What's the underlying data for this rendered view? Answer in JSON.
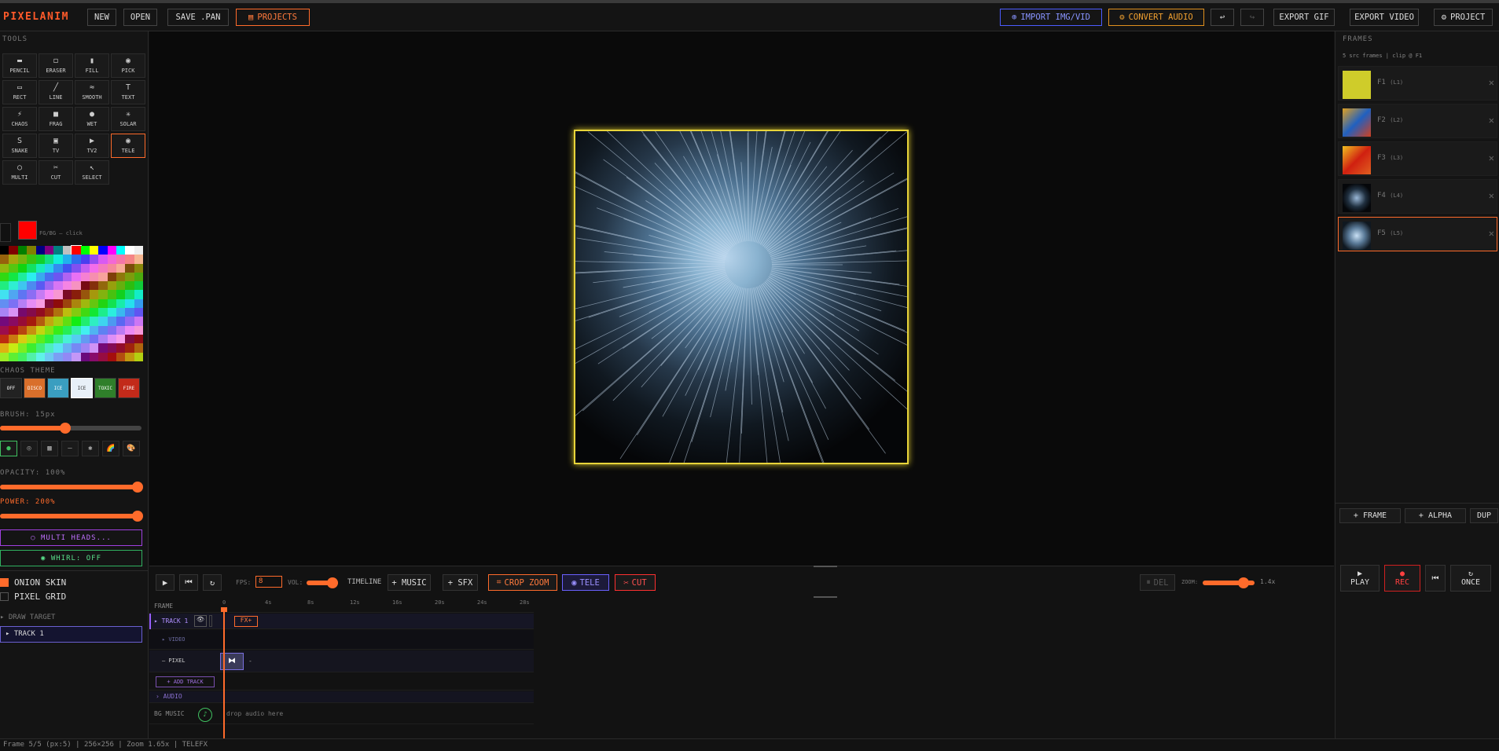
{
  "app": {
    "logo": "PIXELANIM"
  },
  "topbar": {
    "new": "NEW",
    "open": "OPEN",
    "save": "SAVE .PAN",
    "projects": "PROJECTS",
    "import": "IMPORT IMG/VID",
    "convert_audio": "CONVERT AUDIO",
    "undo": "↩",
    "redo": "↪",
    "export_gif": "EXPORT GIF",
    "export_video": "EXPORT VIDEO",
    "project": "PROJECT"
  },
  "tools": {
    "title": "TOOLS",
    "items": [
      {
        "label": "PENCIL",
        "icon": "▬"
      },
      {
        "label": "ERASER",
        "icon": "◻"
      },
      {
        "label": "FILL",
        "icon": "▮"
      },
      {
        "label": "PICK",
        "icon": "◉"
      },
      {
        "label": "RECT",
        "icon": "▭"
      },
      {
        "label": "LINE",
        "icon": "╱"
      },
      {
        "label": "SMOOTH",
        "icon": "≈"
      },
      {
        "label": "TEXT",
        "icon": "T"
      },
      {
        "label": "CHAOS",
        "icon": "⚡"
      },
      {
        "label": "FRAG",
        "icon": "■"
      },
      {
        "label": "WET",
        "icon": "●"
      },
      {
        "label": "SOLAR",
        "icon": "✳"
      },
      {
        "label": "SNAKE",
        "icon": "S"
      },
      {
        "label": "TV",
        "icon": "▣"
      },
      {
        "label": "TV2",
        "icon": "▶"
      },
      {
        "label": "TELE",
        "icon": "◉"
      },
      {
        "label": "MULTI",
        "icon": "○"
      },
      {
        "label": "CUT",
        "icon": "✂"
      },
      {
        "label": "SELECT",
        "icon": "↖"
      }
    ]
  },
  "colors": {
    "fgbg_hint": "FG/BG — click",
    "fg": "#ff0000",
    "bg": "#111111"
  },
  "chaos_theme": {
    "title": "CHAOS THEME",
    "items": [
      {
        "label": "OFF",
        "color": "#222222"
      },
      {
        "label": "DISCO",
        "color": "#d96f2b"
      },
      {
        "label": "ICE",
        "color": "#3a9ec0"
      },
      {
        "label": "ICE",
        "color": "#e8f0f8"
      },
      {
        "label": "TOXIC",
        "color": "#2f7f2a"
      },
      {
        "label": "FIRE",
        "color": "#c22a1a"
      }
    ]
  },
  "brush": {
    "label": "BRUSH: 15px",
    "value_frac": 0.45
  },
  "shapes": [
    "●",
    "◎",
    "▩",
    "—",
    "✱",
    "🌈",
    "🎨"
  ],
  "opacity": {
    "label": "OPACITY: 100%",
    "value_frac": 1.0
  },
  "power": {
    "label": "POWER: 200%",
    "value_frac": 1.0
  },
  "multi_heads": "○ MULTI HEADS...",
  "whirl": "◉ WHIRL: OFF",
  "onion_skin": "ONION SKIN",
  "pixel_grid": "PIXEL GRID",
  "draw_target": {
    "label": "DRAW TARGET",
    "value": "▸ TRACK 1"
  },
  "frames_panel": {
    "title": "FRAMES",
    "info": "5 src frames | clip @ F1",
    "frames": [
      {
        "label": "F1",
        "sub": "(L1)",
        "thumb": "#cfcc2a"
      },
      {
        "label": "F2",
        "sub": "(L2)",
        "thumb": "#c04a20"
      },
      {
        "label": "F3",
        "sub": "(L3)",
        "thumb": "#d03010"
      },
      {
        "label": "F4",
        "sub": "(L4)",
        "thumb": "#0a0a10"
      },
      {
        "label": "F5",
        "sub": "(L5)",
        "thumb": "#6a8cab"
      }
    ],
    "add_frame": "+ FRAME",
    "add_alpha": "+ ALPHA",
    "dup": "DUP",
    "play": "PLAY",
    "rec": "REC",
    "rewind": "⏮",
    "once": "ONCE"
  },
  "timeline": {
    "fps_label": "FPS:",
    "fps": "8",
    "vol_label": "VOL:",
    "timeline_label": "TIMELINE",
    "music": "+ MUSIC",
    "sfx": "+ SFX",
    "crop_zoom": "CROP ZOOM",
    "tele": "TELE",
    "cut": "CUT",
    "del": "DEL",
    "zoom_label": "ZOOM:",
    "zoom": "1.4x",
    "frame_label": "FRAME",
    "ticks": [
      "0",
      "4s",
      "8s",
      "12s",
      "16s",
      "20s",
      "24s",
      "28s"
    ],
    "track1": "▸ TRACK 1",
    "fx": "FX+",
    "video": "▸ VIDEO",
    "pixel": "— PIXEL",
    "pixel_end": "-",
    "add_track": "+ ADD TRACK",
    "audio": "› AUDIO",
    "bg_music": "BG MUSIC",
    "drop_audio": "drop audio here"
  },
  "status": "Frame 5/5 (px:5) | 256×256 | Zoom 1.65x | TELEFX"
}
